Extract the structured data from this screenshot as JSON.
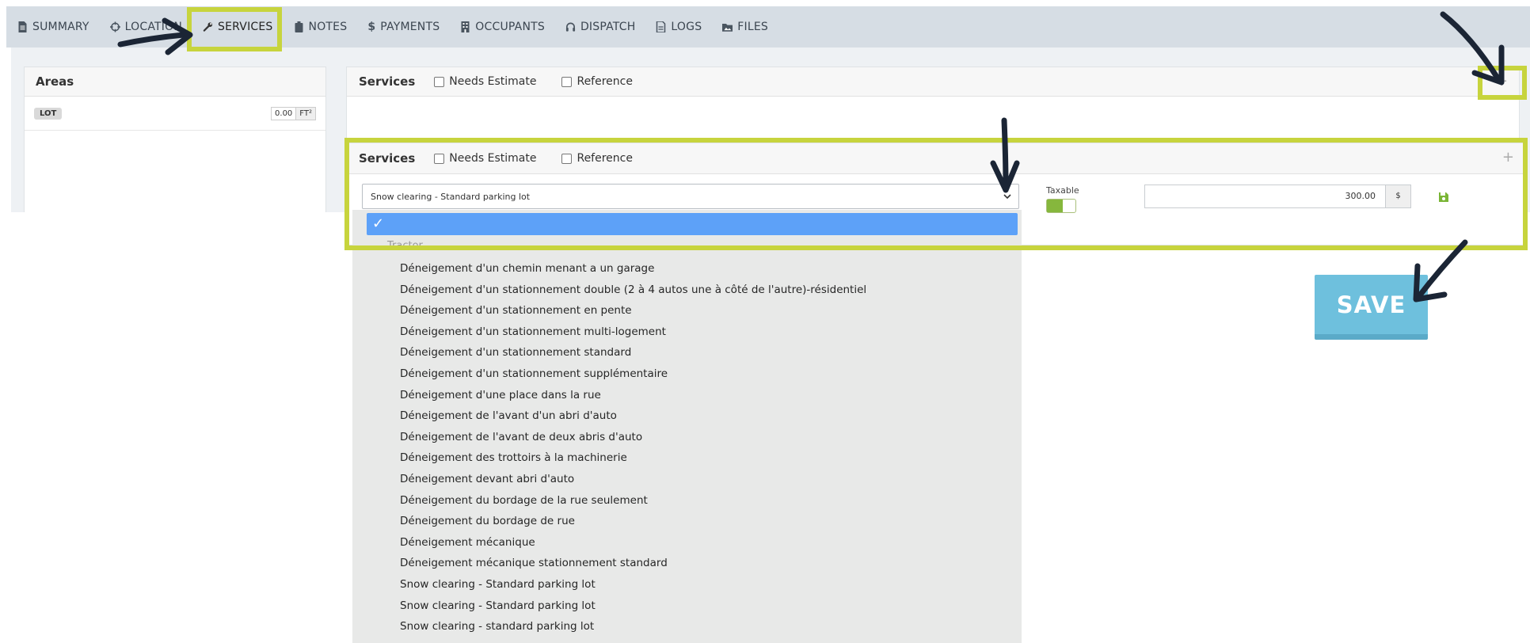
{
  "tabs": [
    {
      "label": "SUMMARY",
      "icon": "document-icon"
    },
    {
      "label": "LOCATION",
      "icon": "crosshair-icon"
    },
    {
      "label": "SERVICES",
      "icon": "wrench-icon",
      "active": true
    },
    {
      "label": "NOTES",
      "icon": "clipboard-icon"
    },
    {
      "label": "PAYMENTS",
      "icon": "dollar-icon"
    },
    {
      "label": "OCCUPANTS",
      "icon": "building-icon"
    },
    {
      "label": "DISPATCH",
      "icon": "headset-icon"
    },
    {
      "label": "LOGS",
      "icon": "file-icon"
    },
    {
      "label": "FILES",
      "icon": "folder-image-icon"
    }
  ],
  "areas": {
    "title": "Areas",
    "rows": [
      {
        "badge": "LOT",
        "value": "0.00",
        "unit": "FT²"
      }
    ]
  },
  "services": {
    "title": "Services",
    "needs_estimate": "Needs Estimate",
    "reference": "Reference",
    "plus": "+"
  },
  "service_line": {
    "selected": "Snow clearing - Standard parking lot",
    "taxable_label": "Taxable",
    "taxable_on": true,
    "price": "300.00",
    "currency": "$"
  },
  "dropdown": {
    "selected_mark": "✓",
    "group": "Tractor",
    "options": [
      "Déneigement d'un chemin menant a un garage",
      "Déneigement d'un stationnement double (2 à 4 autos une à côté de l'autre)-résidentiel",
      "Déneigement d'un stationnement en pente",
      "Déneigement d'un stationnement multi-logement",
      "Déneigement d'un stationnement standard",
      "Déneigement d'un stationnement supplémentaire",
      "Déneigement d'une place dans la rue",
      "Déneigement de l'avant d'un abri d'auto",
      "Déneigement de l'avant de deux abris d'auto",
      "Déneigement des trottoirs à la machinerie",
      "Déneigement devant abri d'auto",
      "Déneigement du bordage de la rue seulement",
      "Déneigement du bordage de rue",
      "Déneigement mécanique",
      "Déneigement mécanique stationnement standard",
      "Snow clearing - Standard parking lot",
      "Snow clearing - Standard parking lot",
      "Snow clearing - standard parking lot"
    ]
  },
  "save_label": "SAVE",
  "colors": {
    "highlight": "#c7d43d",
    "selected_option": "#5da1f8",
    "save_button": "#6ec0dd",
    "toggle_on": "#86b73d",
    "arrow": "#1b2535"
  }
}
